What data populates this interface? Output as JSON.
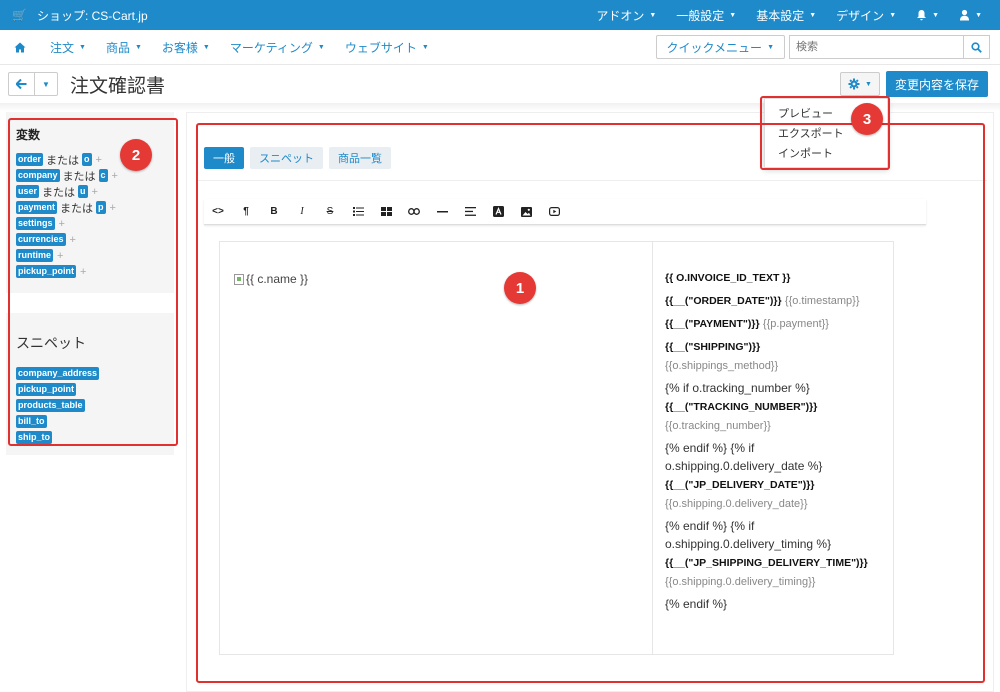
{
  "topbar": {
    "brand": "ショップ: CS-Cart.jp",
    "menus": [
      "アドオン",
      "一般設定",
      "基本設定",
      "デザイン"
    ]
  },
  "nav": {
    "items": [
      "注文",
      "商品",
      "お客様",
      "マーケティング",
      "ウェブサイト"
    ],
    "quick_menu": "クイックメニュー",
    "search_placeholder": "検索"
  },
  "page": {
    "title": "注文確認書",
    "save_label": "変更内容を保存"
  },
  "settings_menu": {
    "items": [
      "プレビュー",
      "エクスポート",
      "インポート"
    ]
  },
  "sidebar": {
    "variables_title": "変数",
    "or_text": "または",
    "variables": [
      {
        "name": "order",
        "short": "o"
      },
      {
        "name": "company",
        "short": "c"
      },
      {
        "name": "user",
        "short": "u"
      },
      {
        "name": "payment",
        "short": "p"
      },
      {
        "name": "settings",
        "short": ""
      },
      {
        "name": "currencies",
        "short": ""
      },
      {
        "name": "runtime",
        "short": ""
      },
      {
        "name": "pickup_point",
        "short": ""
      }
    ],
    "snippets_title": "スニペット",
    "snippets": [
      "company_address",
      "pickup_point",
      "products_table",
      "bill_to",
      "ship_to"
    ]
  },
  "editor": {
    "tabs": [
      "一般",
      "スニペット",
      "商品一覧"
    ],
    "logo_alt": "{{ c.name }}",
    "lines": {
      "invoice_id": "{{ O.INVOICE_ID_TEXT }}",
      "order_date_b": "{{__(\"ORDER_DATE\")}}",
      "order_date_g": "{{o.timestamp}}",
      "payment_b": "{{__(\"PAYMENT\")}}",
      "payment_g": "{{p.payment}}",
      "shipping_b": "{{__(\"SHIPPING\")}}",
      "shipping_g": "{{o.shippings_method}}",
      "if_tracking": "{% if o.tracking_number %}",
      "tracking_b": "{{__(\"TRACKING_NUMBER\")}}",
      "tracking_g": "{{o.tracking_number}}",
      "endif_if_date_1": "{% endif %} {% if",
      "endif_if_date_2": "o.shipping.0.delivery_date %}",
      "delivery_date_b": "{{__(\"JP_DELIVERY_DATE\")}}",
      "delivery_date_g": "{{o.shipping.0.delivery_date}}",
      "endif_if_timing_1": "{% endif %} {% if",
      "endif_if_timing_2": "o.shipping.0.delivery_timing %}",
      "timing_b": "{{__(\"JP_SHIPPING_DELIVERY_TIME\")}}",
      "timing_g": "{{o.shipping.0.delivery_timing}}",
      "endif": "{% endif %}"
    }
  },
  "annotations": [
    "1",
    "2",
    "3"
  ],
  "colors": {
    "accent": "#1f8ac9",
    "highlight": "#e03030",
    "badge": "#e53935"
  }
}
